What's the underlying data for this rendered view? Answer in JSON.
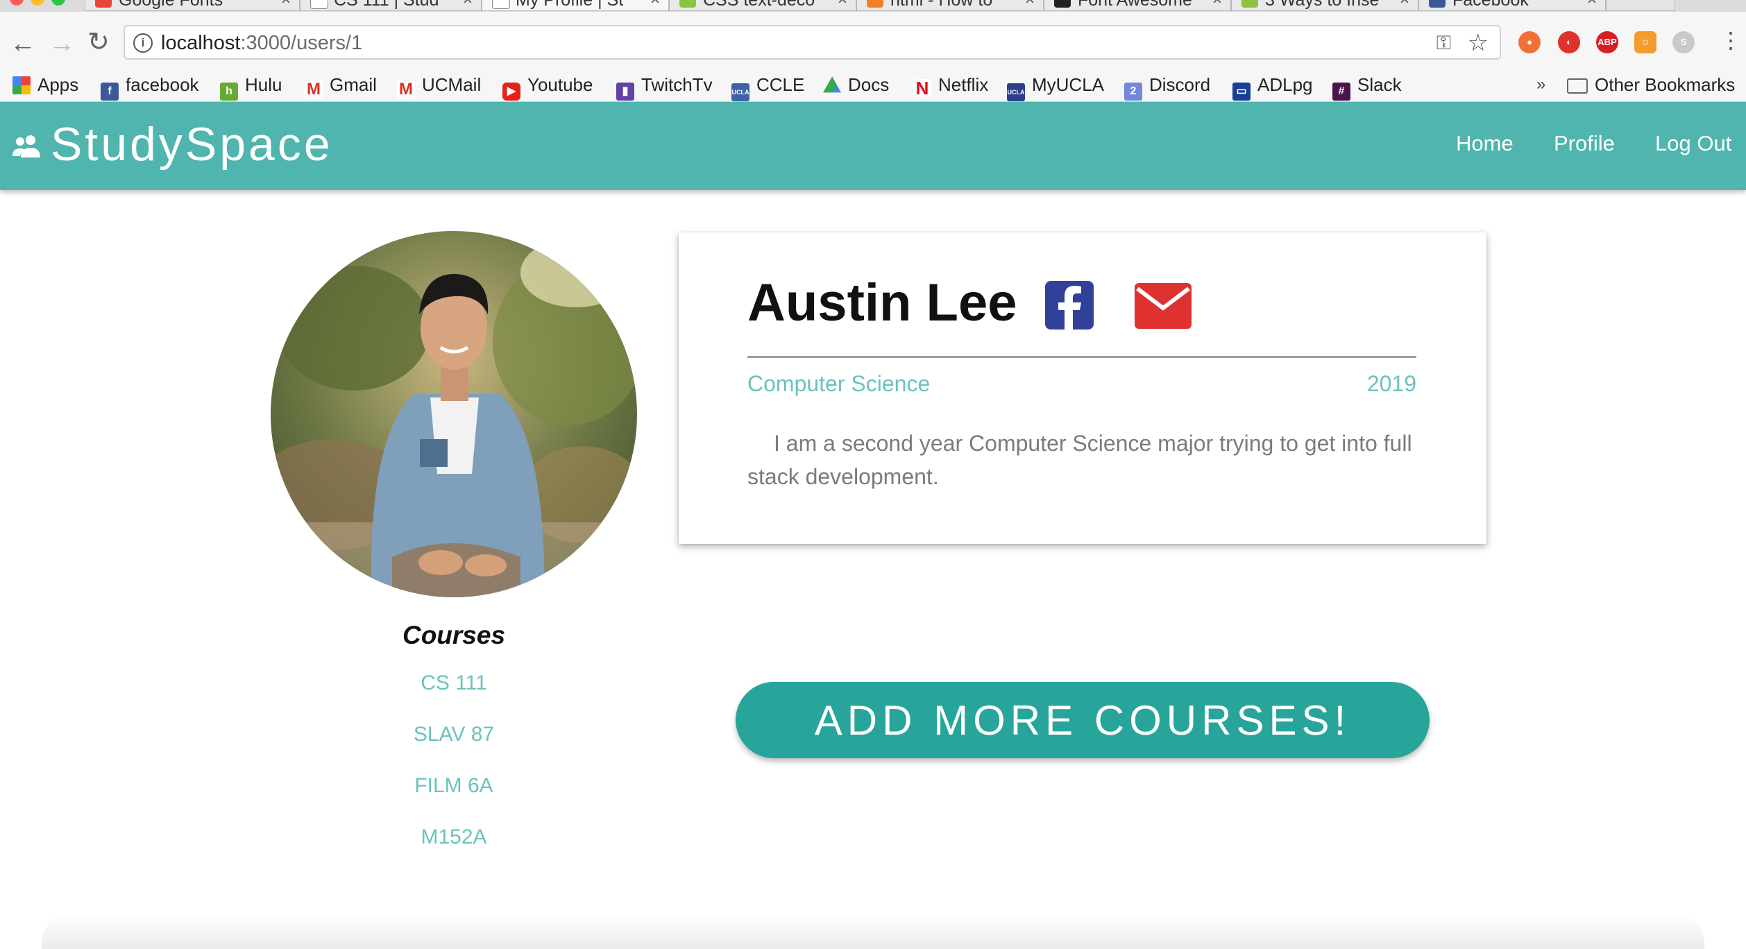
{
  "browser": {
    "tabs": [
      {
        "title": "Google Fonts",
        "active": false
      },
      {
        "title": "CS 111 | Stud",
        "active": false
      },
      {
        "title": "My Profile | St",
        "active": true
      },
      {
        "title": "CSS text-deco",
        "active": false
      },
      {
        "title": "html - How to",
        "active": false
      },
      {
        "title": "Font Awesome",
        "active": false
      },
      {
        "title": "3 Ways to Inse",
        "active": false
      },
      {
        "title": "Facebook",
        "active": false
      }
    ],
    "url_host": "localhost",
    "url_path": ":3000/users/1",
    "bookmarks": [
      {
        "label": "Apps",
        "icon": "apps-grid-icon"
      },
      {
        "label": "facebook",
        "icon": "facebook-icon"
      },
      {
        "label": "Hulu",
        "icon": "hulu-icon"
      },
      {
        "label": "Gmail",
        "icon": "gmail-icon"
      },
      {
        "label": "UCMail",
        "icon": "gmail-icon"
      },
      {
        "label": "Youtube",
        "icon": "youtube-icon"
      },
      {
        "label": "TwitchTv",
        "icon": "twitch-icon"
      },
      {
        "label": "CCLE",
        "icon": "ucla-icon"
      },
      {
        "label": "Docs",
        "icon": "drive-icon"
      },
      {
        "label": "Netflix",
        "icon": "netflix-icon"
      },
      {
        "label": "MyUCLA",
        "icon": "ucla-icon"
      },
      {
        "label": "Discord",
        "icon": "discord-icon"
      },
      {
        "label": "ADLpg",
        "icon": "monitor-icon"
      },
      {
        "label": "Slack",
        "icon": "slack-icon"
      }
    ],
    "other_bookmarks": "Other Bookmarks",
    "overflow": "»"
  },
  "app": {
    "brand": "StudySpace",
    "nav": {
      "home": "Home",
      "profile": "Profile",
      "logout": "Log Out"
    },
    "accent": "#4fb5ae",
    "button_color": "#28a59b",
    "link_color": "#6ac3bb"
  },
  "profile": {
    "name": "Austin Lee",
    "major": "Computer Science",
    "year": "2019",
    "bio": "I am a second year Computer Science major trying to get into full stack development.",
    "courses_title": "Courses",
    "courses": [
      "CS 111",
      "SLAV 87",
      "FILM 6A",
      "M152A"
    ],
    "add_courses_label": "ADD MORE COURSES!"
  }
}
